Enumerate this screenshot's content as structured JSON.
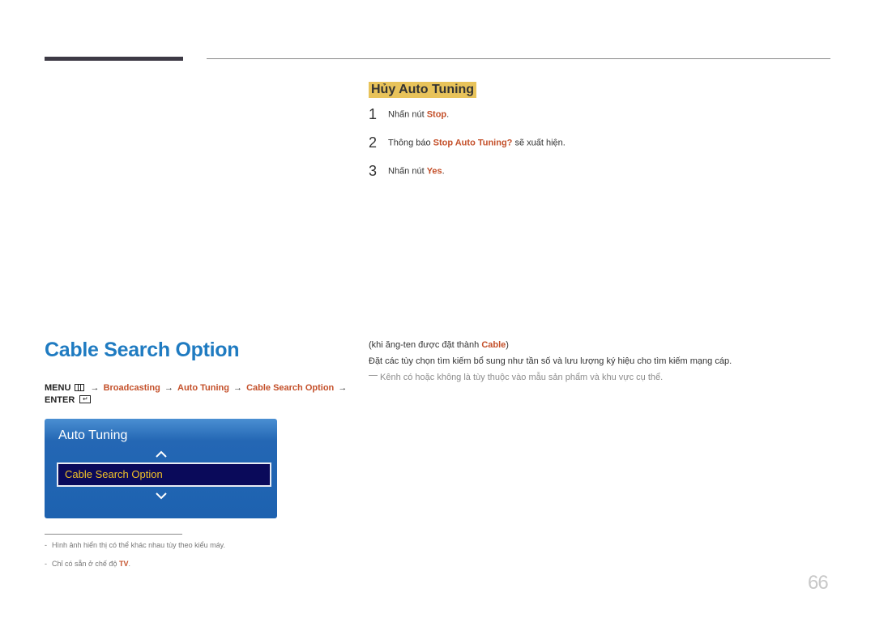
{
  "cancel_section": {
    "heading": "Hủy Auto Tuning",
    "steps": [
      {
        "num": "1",
        "pre": "Nhấn nút ",
        "hl": "Stop",
        "post": "."
      },
      {
        "num": "2",
        "pre": "Thông báo ",
        "hl": "Stop Auto Tuning?",
        "post": " sẽ xuất hiện."
      },
      {
        "num": "3",
        "pre": "Nhấn nút ",
        "hl": "Yes",
        "post": "."
      }
    ]
  },
  "section": {
    "title": "Cable Search Option",
    "menu_path": {
      "menu": "MENU",
      "arrow": "→",
      "items": [
        "Broadcasting",
        "Auto Tuning",
        "Cable Search Option"
      ],
      "enter": "ENTER"
    },
    "condition_pre": "(khi ăng-ten được đặt thành ",
    "condition_hl": "Cable",
    "condition_post": ")",
    "description": "Đặt các tùy chọn tìm kiếm bổ sung như tần số và lưu lượng ký hiệu cho tìm kiếm mạng cáp.",
    "note": "Kênh có hoặc không là tùy thuộc vào mẫu sản phẩm và khu vực cụ thể."
  },
  "osd": {
    "title": "Auto Tuning",
    "selected_item": "Cable Search Option",
    "up_icon": "chevron-up",
    "down_icon": "chevron-down"
  },
  "footnotes": [
    {
      "dash": "-",
      "text": "Hình ảnh hiển thị có thể khác nhau tùy theo kiểu máy.",
      "hl": ""
    },
    {
      "dash": "-",
      "text": "Chỉ có sẵn ở chế độ ",
      "hl": "TV",
      "post": "."
    }
  ],
  "page_number": "66"
}
